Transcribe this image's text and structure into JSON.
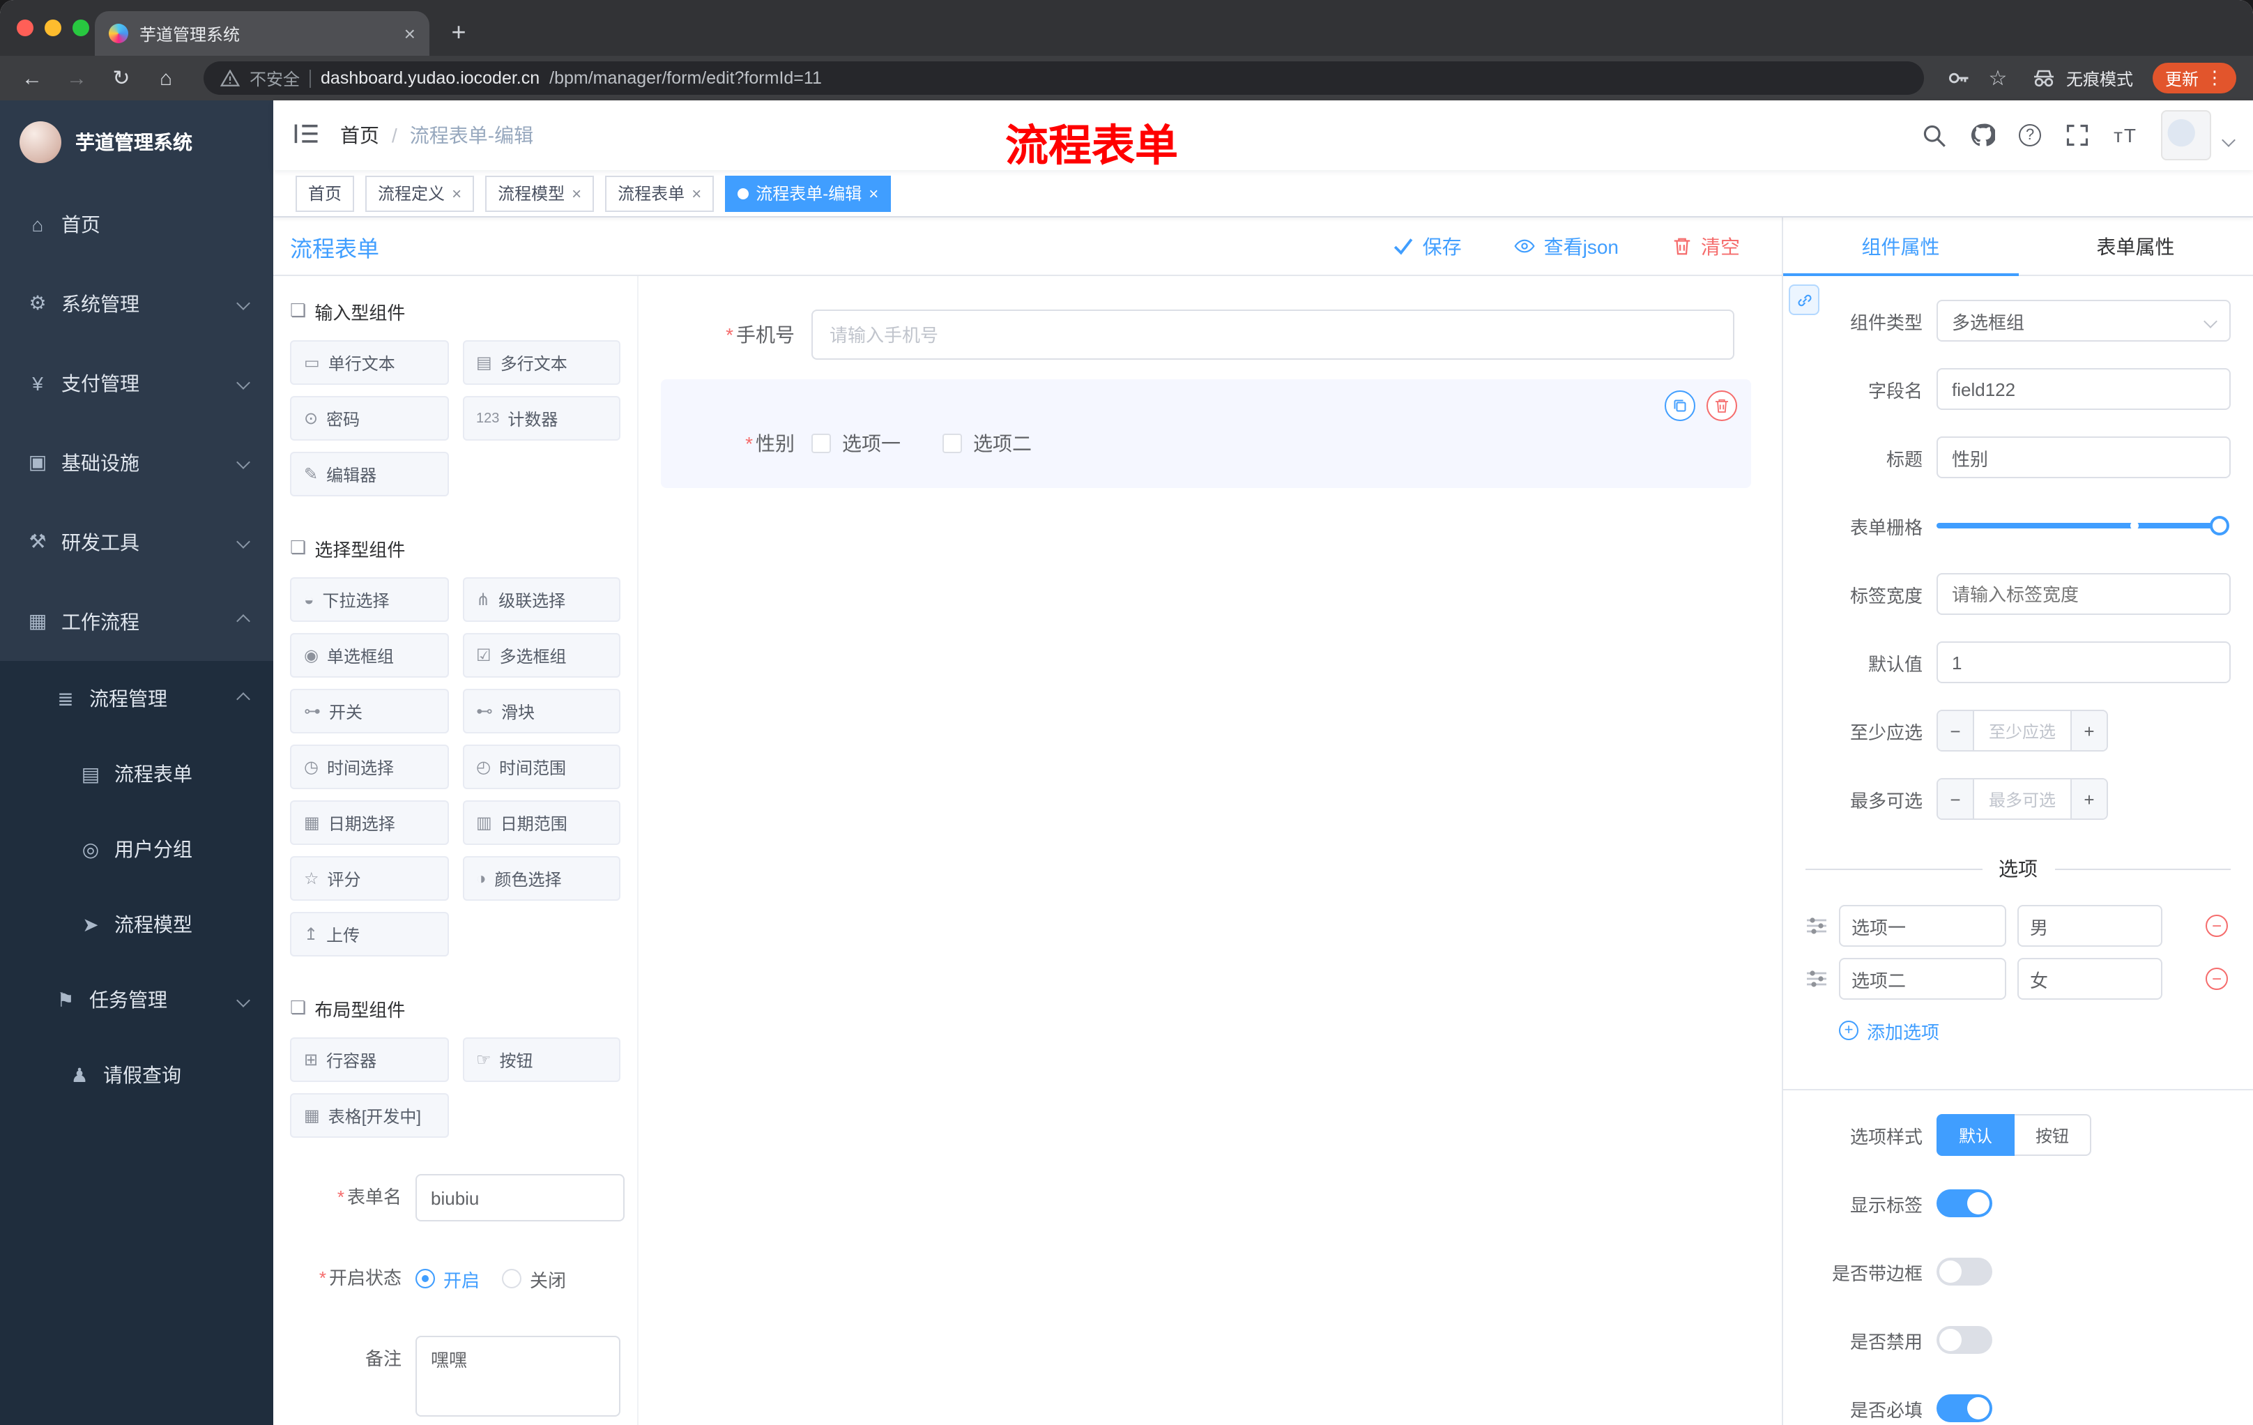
{
  "colors": {
    "primary": "#409eff",
    "danger": "#f56c6c",
    "annotation_red": "#ff0000",
    "update_pill": "#e2552c",
    "traffic_red": "#ff5f57",
    "traffic_yellow": "#febc2e",
    "traffic_green": "#28c840"
  },
  "glyphs": {
    "close": "×",
    "plus": "+",
    "minus": "−",
    "star": "*",
    "back": "←",
    "forward": "→",
    "reload": "↻",
    "home": "⌂",
    "ellipsis": "⋮",
    "question": "?",
    "bookmark": "☆",
    "text_size": "тT",
    "breadcrumb_sep": "/"
  },
  "browser": {
    "tab_title": "芋道管理系统",
    "security_label": "不安全",
    "url_host": "dashboard.yudao.iocoder.cn",
    "url_path": "/bpm/manager/form/edit?formId=11",
    "incognito_label": "无痕模式",
    "update_label": "更新"
  },
  "annotation": {
    "text": "流程表单"
  },
  "sidebar": {
    "logo_title": "芋道管理系统",
    "items": [
      {
        "icon": "⌂",
        "label": "首页"
      },
      {
        "icon": "⚙",
        "label": "系统管理"
      },
      {
        "icon": "¥",
        "label": "支付管理"
      },
      {
        "icon": "▣",
        "label": "基础设施"
      },
      {
        "icon": "⚒",
        "label": "研发工具"
      },
      {
        "icon": "▦",
        "label": "工作流程"
      },
      {
        "icon": "≣",
        "label": "流程管理"
      },
      {
        "icon": "▤",
        "label": "流程表单"
      },
      {
        "icon": "◎",
        "label": "用户分组"
      },
      {
        "icon": "➤",
        "label": "流程模型"
      },
      {
        "icon": "⚑",
        "label": "任务管理"
      },
      {
        "icon": "♟",
        "label": "请假查询"
      }
    ]
  },
  "navbar": {
    "breadcrumb_home": "首页",
    "breadcrumb_current": "流程表单-编辑"
  },
  "tags": [
    {
      "label": "首页"
    },
    {
      "label": "流程定义"
    },
    {
      "label": "流程模型"
    },
    {
      "label": "流程表单"
    },
    {
      "label": "流程表单-编辑"
    }
  ],
  "ws": {
    "title": "流程表单",
    "save": "保存",
    "view_json": "查看json",
    "clear": "清空"
  },
  "palette": {
    "groups": [
      {
        "title": "输入型组件",
        "items": [
          {
            "icon": "▭",
            "label": "单行文本"
          },
          {
            "icon": "▤",
            "label": "多行文本"
          },
          {
            "icon": "⊙",
            "label": "密码"
          },
          {
            "icon": "123",
            "label": "计数器"
          },
          {
            "icon": "✎",
            "label": "编辑器"
          }
        ]
      },
      {
        "title": "选择型组件",
        "items": [
          {
            "icon": "◒",
            "label": "下拉选择"
          },
          {
            "icon": "⋔",
            "label": "级联选择"
          },
          {
            "icon": "◉",
            "label": "单选框组"
          },
          {
            "icon": "☑",
            "label": "多选框组"
          },
          {
            "icon": "⊶",
            "label": "开关"
          },
          {
            "icon": "⊷",
            "label": "滑块"
          },
          {
            "icon": "◷",
            "label": "时间选择"
          },
          {
            "icon": "◴",
            "label": "时间范围"
          },
          {
            "icon": "▦",
            "label": "日期选择"
          },
          {
            "icon": "▥",
            "label": "日期范围"
          },
          {
            "icon": "☆",
            "label": "评分"
          },
          {
            "icon": "◑",
            "label": "颜色选择"
          },
          {
            "icon": "↥",
            "label": "上传"
          }
        ]
      },
      {
        "title": "布局型组件",
        "items": [
          {
            "icon": "⊞",
            "label": "行容器"
          },
          {
            "icon": "☞",
            "label": "按钮"
          },
          {
            "icon": "▦",
            "label": "表格[开发中]"
          }
        ]
      }
    ]
  },
  "meta": {
    "form_name_label": "表单名",
    "form_name_value": "biubiu",
    "status_label": "开启状态",
    "status_on": "开启",
    "status_off": "关闭",
    "remark_label": "备注",
    "remark_value": "嘿嘿"
  },
  "canvas": {
    "phone_label": "手机号",
    "phone_placeholder": "请输入手机号",
    "gender_label": "性别",
    "gender_options": [
      "选项一",
      "选项二"
    ]
  },
  "panel": {
    "tabs": [
      "组件属性",
      "表单属性"
    ],
    "type_label": "组件类型",
    "type_value": "多选框组",
    "field_label": "字段名",
    "field_value": "field122",
    "title_label": "标题",
    "title_value": "性别",
    "grid_label": "表单栅格",
    "label_width_label": "标签宽度",
    "label_width_placeholder": "请输入标签宽度",
    "default_label": "默认值",
    "default_value": "1",
    "min_label": "至少应选",
    "min_placeholder": "至少应选",
    "max_label": "最多可选",
    "max_placeholder": "最多可选",
    "options_divider": "选项",
    "options": [
      {
        "name": "选项一",
        "value": "男"
      },
      {
        "name": "选项二",
        "value": "女"
      }
    ],
    "add_option": "添加选项",
    "style_label": "选项样式",
    "style_default": "默认",
    "style_button": "按钮",
    "show_label": "显示标签",
    "border_label": "是否带边框",
    "disabled_label": "是否禁用",
    "required_label": "是否必填"
  }
}
